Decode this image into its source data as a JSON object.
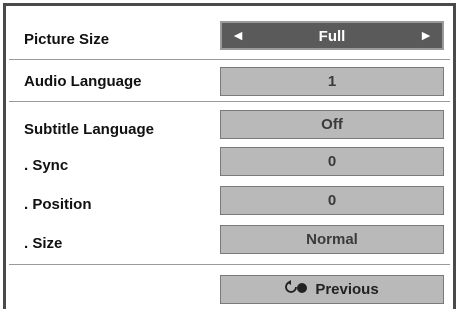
{
  "rows": [
    {
      "label": "Picture Size",
      "value": "Full"
    },
    {
      "label": "Audio Language",
      "value": "1"
    },
    {
      "label": "Subtitle Language",
      "value": "Off"
    },
    {
      "label": ". Sync",
      "value": "0"
    },
    {
      "label": ". Position",
      "value": "0"
    },
    {
      "label": ". Size",
      "value": "Normal"
    }
  ],
  "arrows": {
    "left": "◄",
    "right": "►"
  },
  "footer": {
    "previous_label": "Previous",
    "icon": "return-icon"
  },
  "colors": {
    "active_bg": "#5a5a5a",
    "box_bg": "#b9b9b9",
    "frame": "#4a4a4a"
  }
}
